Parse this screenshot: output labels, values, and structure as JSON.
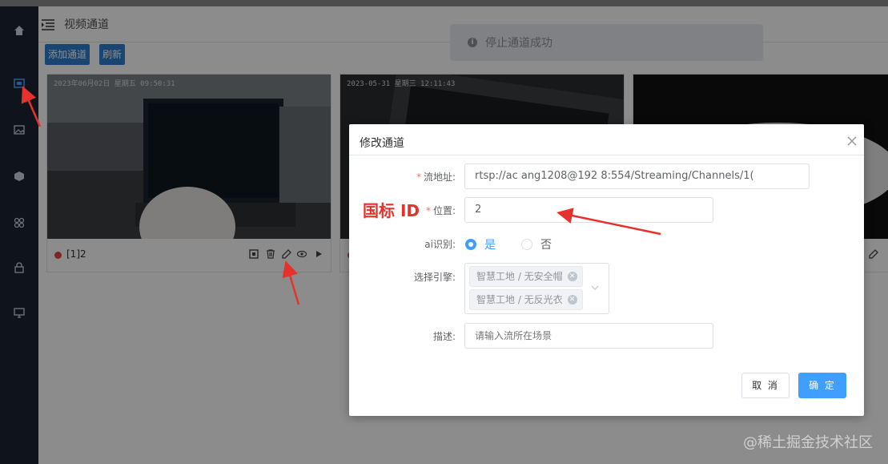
{
  "header": {
    "title": "视频通道"
  },
  "toolbar": {
    "add_label": "添加通道",
    "refresh_label": "刷新"
  },
  "toast": {
    "message": "停止通道成功"
  },
  "sidebar": {
    "icons": [
      "home-icon",
      "video-icon",
      "image-icon",
      "cube-icon",
      "apps-icon",
      "lock-icon",
      "monitor-icon"
    ]
  },
  "cards": [
    {
      "timestamp": "2023年06月02日 星期五 09:50:31",
      "label": "[1]2",
      "status_color": "#e04a3f"
    },
    {
      "timestamp": "2023-05-31 星期三 12:11:43",
      "label": ""
    },
    {
      "timestamp": "",
      "label": ""
    }
  ],
  "dialog": {
    "title": "修改通道",
    "fields": {
      "url_label": "流地址:",
      "url_value": "rtsp://ac          ang1208@192          8:554/Streaming/Channels/1(",
      "position_label": "位置:",
      "position_value": "2",
      "ai_label": "ai识别:",
      "ai_yes": "是",
      "ai_no": "否",
      "engine_label": "选择引擎:",
      "engine_tags": [
        "智慧工地 / 无安全帽",
        "智慧工地 / 无反光衣"
      ],
      "desc_label": "描述:",
      "desc_placeholder": "请输入流所在场景"
    },
    "cancel_label": "取 消",
    "confirm_label": "确 定"
  },
  "annotation": {
    "text": "国标 ID"
  },
  "watermark": {
    "text": "@稀土掘金技术社区"
  },
  "colors": {
    "primary": "#409eff",
    "sidebar": "#1d2633",
    "annotation": "#e5322d"
  }
}
